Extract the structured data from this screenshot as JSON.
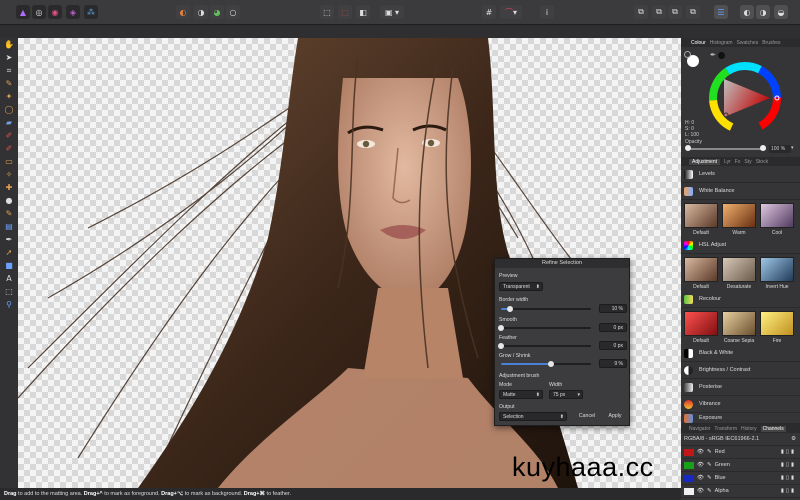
{
  "app": {
    "name": "Affinity Photo"
  },
  "toolbar": {
    "persona_icons": [
      "affinity-logo-icon",
      "photo-persona-icon",
      "liquify-persona-icon",
      "develop-persona-icon",
      "export-persona-icon"
    ],
    "info_label": "i"
  },
  "tools": [
    "move",
    "select",
    "crop",
    "picker",
    "selection-brush",
    "marquee",
    "flood-fill",
    "paint-brush",
    "color-replace",
    "erase",
    "clone",
    "healing",
    "blur",
    "dodge",
    "gradient",
    "pen",
    "node",
    "shape",
    "text",
    "zoom"
  ],
  "status": {
    "text_a": "Drag",
    "text_b": " to add to the matting area. ",
    "text_c": "Drag+^",
    "text_d": " to mark as foreground. ",
    "text_e": "Drag+⌥",
    "text_f": " to mark as background. ",
    "text_g": "Drag+⌘",
    "text_h": " to feather."
  },
  "colour_panel": {
    "tabs": [
      "Colour",
      "Histogram",
      "Swatches",
      "Brushes"
    ],
    "h": "H: 0",
    "s": "S: 0",
    "l": "L: 100",
    "opacity_label": "Opacity",
    "opacity_value": "100 %",
    "opacity_fraction": 1.0
  },
  "adjustment_panel": {
    "tabs": [
      "Adjustment",
      "Lyr",
      "Fx",
      "Sty",
      "Stock"
    ],
    "rows": {
      "levels": "Levels",
      "white_balance": "White Balance",
      "hsl": "HSL Adjust",
      "recolour": "Recolour",
      "bw": "Black & White",
      "brightness": "Brightness / Contrast",
      "posterise": "Posterise",
      "vibrance": "Vibrance",
      "exposure": "Exposure"
    },
    "wb_presets": [
      "Default",
      "Warm",
      "Cool"
    ],
    "hsl_presets": [
      "Default",
      "Desaturate",
      "Invert Hue"
    ],
    "recolour_presets": [
      "Default",
      "Coarse Sepia",
      "Fire"
    ]
  },
  "channels_panel": {
    "tabs": [
      "Navigator",
      "Transform",
      "History",
      "Channels"
    ],
    "profile": "RGBA/8 - sRGB IEC61966-2.1",
    "channels": [
      "Red",
      "Green",
      "Blue",
      "Alpha"
    ]
  },
  "dialog": {
    "title": "Refine Selection",
    "preview_label": "Preview",
    "preview_value": "Transparent",
    "border_label": "Border width",
    "border_value": "10 %",
    "border_fraction": 0.1,
    "smooth_label": "Smooth",
    "smooth_value": "0 px",
    "smooth_fraction": 0,
    "feather_label": "Feather",
    "feather_value": "0 px",
    "feather_fraction": 0,
    "grow_label": "Grow / Shrink",
    "grow_value": "9 %",
    "grow_fraction": 0.55,
    "brush_label": "Adjustment brush",
    "mode_label": "Mode",
    "mode_value": "Matte",
    "width_label": "Width",
    "width_value": "75 px",
    "output_label": "Output",
    "output_value": "Selection",
    "cancel": "Cancel",
    "apply": "Apply"
  },
  "watermark": "kuyhaaa.cc"
}
